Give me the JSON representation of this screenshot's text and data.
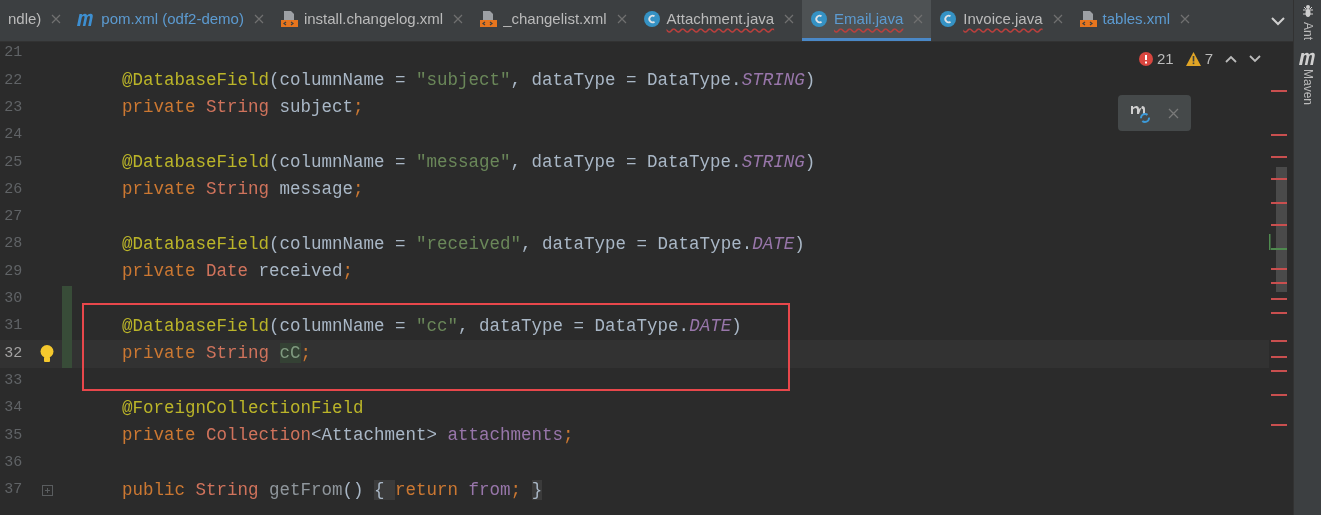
{
  "tabs": [
    {
      "kind": "plain",
      "label": "ndle)",
      "selected": false,
      "modified": false,
      "error": false
    },
    {
      "kind": "maven",
      "label": "pom.xml (odf2-demo)",
      "selected": false,
      "modified": true,
      "error": false
    },
    {
      "kind": "xml",
      "label": "install.changelog.xml",
      "selected": false,
      "modified": false,
      "error": false
    },
    {
      "kind": "xml",
      "label": "_changelist.xml",
      "selected": false,
      "modified": false,
      "error": false
    },
    {
      "kind": "java",
      "label": "Attachment.java",
      "selected": false,
      "modified": false,
      "error": true
    },
    {
      "kind": "java",
      "label": "Email.java",
      "selected": true,
      "modified": true,
      "error": true
    },
    {
      "kind": "java",
      "label": "Invoice.java",
      "selected": false,
      "modified": false,
      "error": true
    },
    {
      "kind": "xml",
      "label": "tables.xml",
      "selected": false,
      "modified": true,
      "error": false
    }
  ],
  "inspections": {
    "errors": "21",
    "warnings": "7"
  },
  "tool_windows": [
    "Ant",
    "Maven"
  ],
  "code_lines": [
    {
      "number": "21",
      "current": false
    },
    {
      "number": "22",
      "current": false,
      "tokens": [
        {
          "kind": "annotation",
          "text": "@DatabaseField"
        },
        {
          "kind": "plain",
          "text": "(columnName = "
        },
        {
          "kind": "string",
          "text": "\"subject\""
        },
        {
          "kind": "plain",
          "text": ", dataType = DataType."
        },
        {
          "kind": "constant",
          "text": "STRING"
        },
        {
          "kind": "plain",
          "text": ")"
        }
      ]
    },
    {
      "number": "23",
      "current": false,
      "tokens": [
        {
          "kind": "keyword",
          "text": "private "
        },
        {
          "kind": "type",
          "text": "String "
        },
        {
          "kind": "plain",
          "text": "subject"
        },
        {
          "kind": "keyword",
          "text": ";"
        }
      ]
    },
    {
      "number": "24",
      "current": false
    },
    {
      "number": "25",
      "current": false,
      "tokens": [
        {
          "kind": "annotation",
          "text": "@DatabaseField"
        },
        {
          "kind": "plain",
          "text": "(columnName = "
        },
        {
          "kind": "string",
          "text": "\"message\""
        },
        {
          "kind": "plain",
          "text": ", dataType = DataType."
        },
        {
          "kind": "constant",
          "text": "STRING"
        },
        {
          "kind": "plain",
          "text": ")"
        }
      ]
    },
    {
      "number": "26",
      "current": false,
      "tokens": [
        {
          "kind": "keyword",
          "text": "private "
        },
        {
          "kind": "type",
          "text": "String "
        },
        {
          "kind": "plain",
          "text": "message"
        },
        {
          "kind": "keyword",
          "text": ";"
        }
      ]
    },
    {
      "number": "27",
      "current": false
    },
    {
      "number": "28",
      "current": false,
      "tokens": [
        {
          "kind": "annotation",
          "text": "@DatabaseField"
        },
        {
          "kind": "plain",
          "text": "(columnName = "
        },
        {
          "kind": "string",
          "text": "\"received\""
        },
        {
          "kind": "plain",
          "text": ", dataType = DataType."
        },
        {
          "kind": "constant",
          "text": "DATE"
        },
        {
          "kind": "plain",
          "text": ")"
        }
      ]
    },
    {
      "number": "29",
      "current": false,
      "tokens": [
        {
          "kind": "keyword",
          "text": "private "
        },
        {
          "kind": "type",
          "text": "Date "
        },
        {
          "kind": "plain",
          "text": "received"
        },
        {
          "kind": "keyword",
          "text": ";"
        }
      ]
    },
    {
      "number": "30",
      "current": false,
      "changed": true
    },
    {
      "number": "31",
      "current": false,
      "changed": true,
      "boxed": true,
      "tokens": [
        {
          "kind": "annotation",
          "text": "@DatabaseField"
        },
        {
          "kind": "plain",
          "text": "(columnName = "
        },
        {
          "kind": "string",
          "text": "\"cc\""
        },
        {
          "kind": "plain",
          "text": ", dataType = DataType."
        },
        {
          "kind": "constant",
          "text": "DATE"
        },
        {
          "kind": "plain",
          "text": ")"
        }
      ]
    },
    {
      "number": "32",
      "current": true,
      "changed": true,
      "bulb": true,
      "boxed": true,
      "tokens": [
        {
          "kind": "keyword",
          "text": "private "
        },
        {
          "kind": "type",
          "text": "String "
        },
        {
          "kind": "unused",
          "text": "cC"
        },
        {
          "kind": "keyword",
          "text": ";"
        }
      ]
    },
    {
      "number": "33",
      "current": false,
      "boxed": true
    },
    {
      "number": "34",
      "current": false,
      "tokens": [
        {
          "kind": "annotation",
          "text": "@ForeignCollectionField"
        }
      ]
    },
    {
      "number": "35",
      "current": false,
      "tokens": [
        {
          "kind": "keyword",
          "text": "private "
        },
        {
          "kind": "type",
          "text": "Collection"
        },
        {
          "kind": "plain",
          "text": "<Attachment> "
        },
        {
          "kind": "field",
          "text": "attachments"
        },
        {
          "kind": "keyword",
          "text": ";"
        }
      ]
    },
    {
      "number": "36",
      "current": false
    },
    {
      "number": "37",
      "current": false,
      "fold": true,
      "tokens": [
        {
          "kind": "keyword",
          "text": "public "
        },
        {
          "kind": "type",
          "text": "String "
        },
        {
          "kind": "method",
          "text": "getFrom"
        },
        {
          "kind": "plain",
          "text": "() "
        },
        {
          "kind": "folded",
          "text": "{ "
        },
        {
          "kind": "keyword",
          "text": "return "
        },
        {
          "kind": "field",
          "text": "from"
        },
        {
          "kind": "keyword",
          "text": "; "
        },
        {
          "kind": "folded",
          "text": "}"
        }
      ]
    }
  ]
}
